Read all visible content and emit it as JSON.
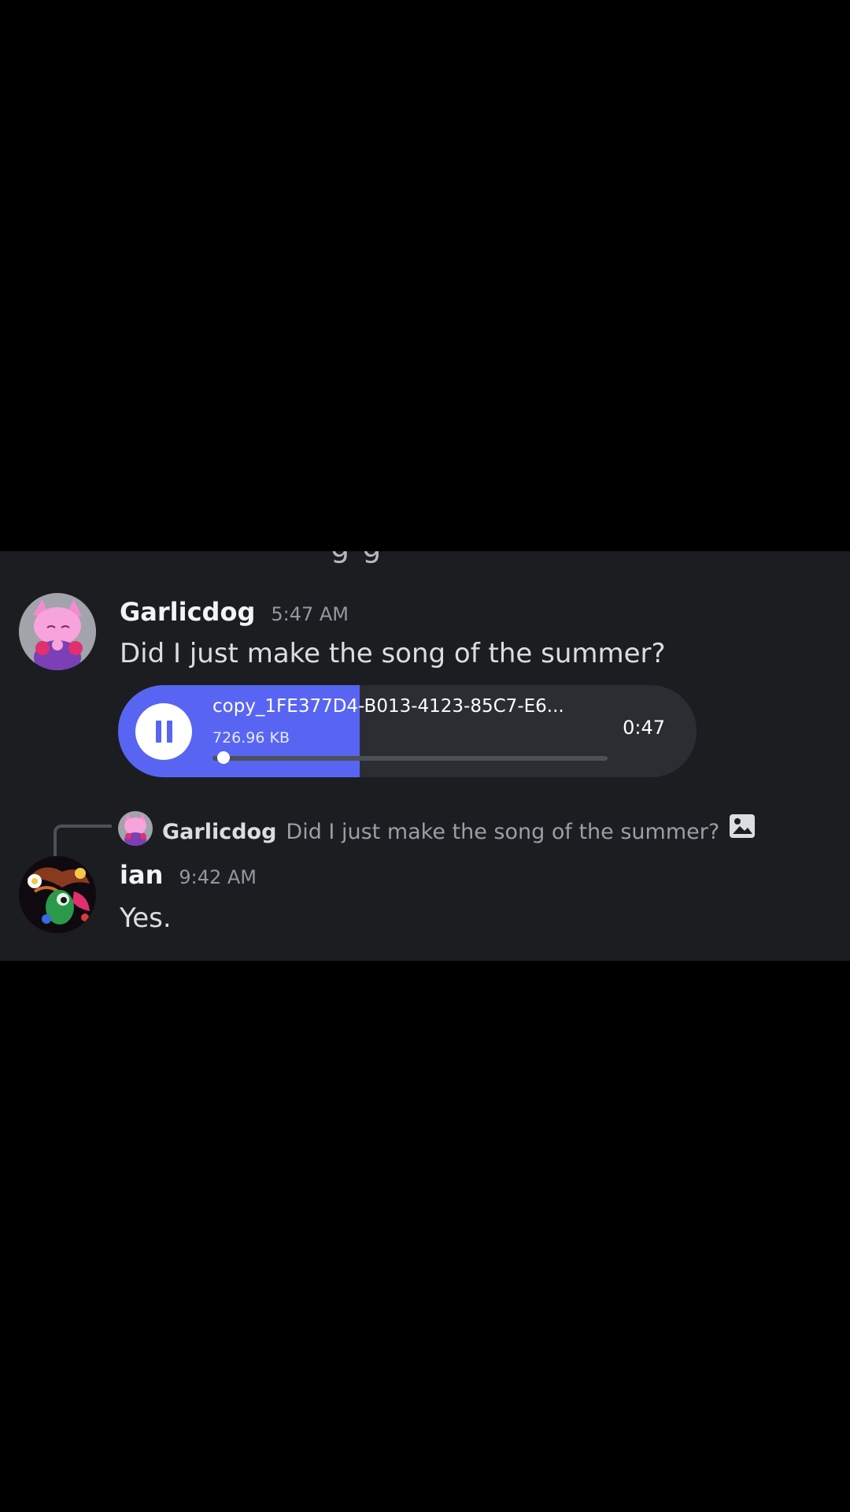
{
  "top_partial_text": "g g",
  "messages": [
    {
      "username": "Garlicdog",
      "timestamp": "5:47 AM",
      "text": "Did I just make the song of the summer?",
      "avatar_icon": "pink-cat-avatar",
      "attachment": {
        "type": "voice-message",
        "file_name": "copy_1FE377D4-B013-4123-85C7-E6...",
        "file_size": "726.96 KB",
        "duration": "0:47",
        "playback_state": "playing",
        "progress_fraction": 0.02,
        "play_icon": "pause-icon"
      }
    },
    {
      "username": "ian",
      "timestamp": "9:42 AM",
      "text": "Yes.",
      "avatar_icon": "colorful-creature-avatar",
      "reply_to": {
        "username": "Garlicdog",
        "text": "Did I just make the song of the summer?",
        "attachment_icon": "image-icon"
      }
    }
  ],
  "colors": {
    "background": "#000000",
    "panel": "#1c1d21",
    "accent": "#5865f2",
    "voice_pill": "#2b2d33"
  }
}
